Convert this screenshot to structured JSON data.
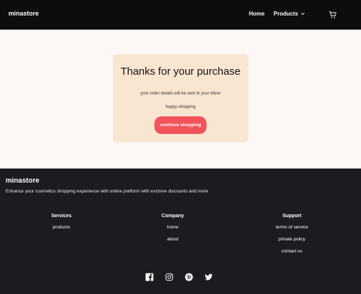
{
  "navbar": {
    "brand": "minastore",
    "links": {
      "home": "Home",
      "products": "Products"
    },
    "icons": {
      "dropdown": "chevron-down-icon",
      "cart": "cart-icon"
    }
  },
  "confirmation": {
    "title": "Thanks for your purchase",
    "message": "your order details will be sent to your inbox",
    "subtext": "happy shopping",
    "button_label": "continue shopping",
    "button_color": "#f0545a",
    "card_color": "#f9e6d2"
  },
  "footer": {
    "brand": "minastore",
    "tagline": "Enhance your cosmetics shopping experience with online platform with exclsive discounts and more",
    "columns": {
      "services": {
        "heading": "Services",
        "links": [
          "products"
        ]
      },
      "company": {
        "heading": "Company",
        "links": [
          "home",
          "about"
        ]
      },
      "support": {
        "heading": "Support",
        "links": [
          "terms of service",
          "private policy",
          "contact us"
        ]
      }
    },
    "socials": [
      "facebook-icon",
      "instagram-icon",
      "pinterest-icon",
      "twitter-icon"
    ],
    "background": "#1c1b20"
  }
}
